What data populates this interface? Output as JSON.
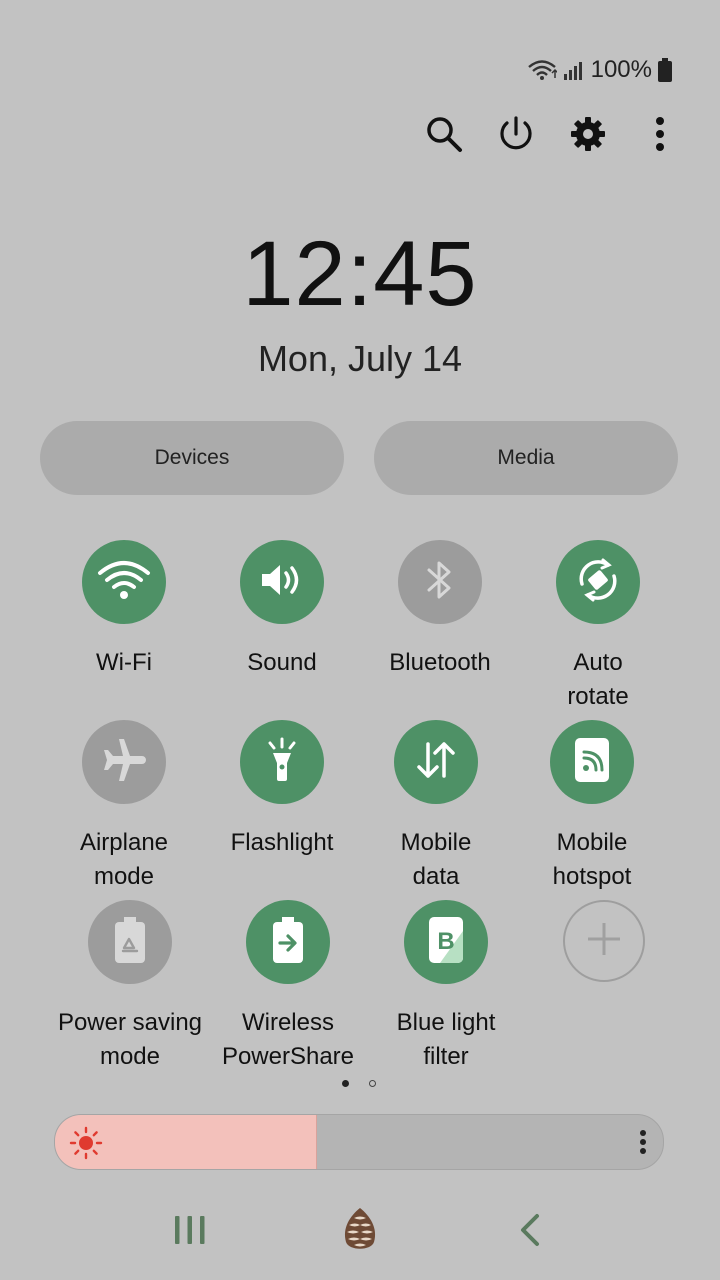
{
  "status_bar": {
    "battery_text": "100%",
    "wifi_icon": "wifi-icon",
    "signal_icon": "signal-bars-icon",
    "battery_icon": "battery-full-icon"
  },
  "top_actions": [
    {
      "name": "search-button",
      "icon": "search-icon"
    },
    {
      "name": "power-button",
      "icon": "power-icon"
    },
    {
      "name": "settings-button",
      "icon": "gear-icon"
    },
    {
      "name": "more-options-button",
      "icon": "vertical-dots-icon"
    }
  ],
  "clock": {
    "time": "12:45",
    "date": "Mon, July 14"
  },
  "pills": {
    "devices": "Devices",
    "media": "Media"
  },
  "tiles": [
    {
      "label": "Wi-Fi",
      "state": "on",
      "icon": "wifi-icon"
    },
    {
      "label": "Sound",
      "state": "on",
      "icon": "speaker-icon"
    },
    {
      "label": "Bluetooth",
      "state": "off",
      "icon": "bluetooth-icon"
    },
    {
      "label": "Auto\nrotate",
      "state": "on",
      "icon": "auto-rotate-icon"
    },
    {
      "label": "Airplane\nmode",
      "state": "off",
      "icon": "airplane-icon"
    },
    {
      "label": "Flashlight",
      "state": "on",
      "icon": "flashlight-icon"
    },
    {
      "label": "Mobile\ndata",
      "state": "on",
      "icon": "mobile-data-arrows-icon"
    },
    {
      "label": "Mobile\nhotspot",
      "state": "on",
      "icon": "hotspot-icon"
    },
    {
      "label": "Power saving\nmode",
      "state": "off",
      "icon": "power-saving-icon"
    },
    {
      "label": "Wireless\nPowerShare",
      "state": "on",
      "icon": "wireless-powershare-icon"
    },
    {
      "label": "Blue light\nfilter",
      "state": "on",
      "icon": "blue-light-filter-icon"
    },
    {
      "label": "",
      "state": "add",
      "icon": "plus-icon"
    }
  ],
  "pager": {
    "current_page": 1,
    "total_pages": 2
  },
  "brightness": {
    "level": 0.43,
    "icon": "sun-icon",
    "menu_icon": "vertical-dots-icon"
  },
  "nav_bar": {
    "recents_icon": "recents-icon",
    "home_icon": "pinecone-home-icon",
    "back_icon": "back-chevron-icon"
  },
  "colors": {
    "background": "#c2c2c2",
    "tile_on": "#4e9166",
    "tile_off": "#9c9c9c",
    "brightness_fill": "#f3c1bb",
    "nav_icons": "#5a7a5e"
  }
}
